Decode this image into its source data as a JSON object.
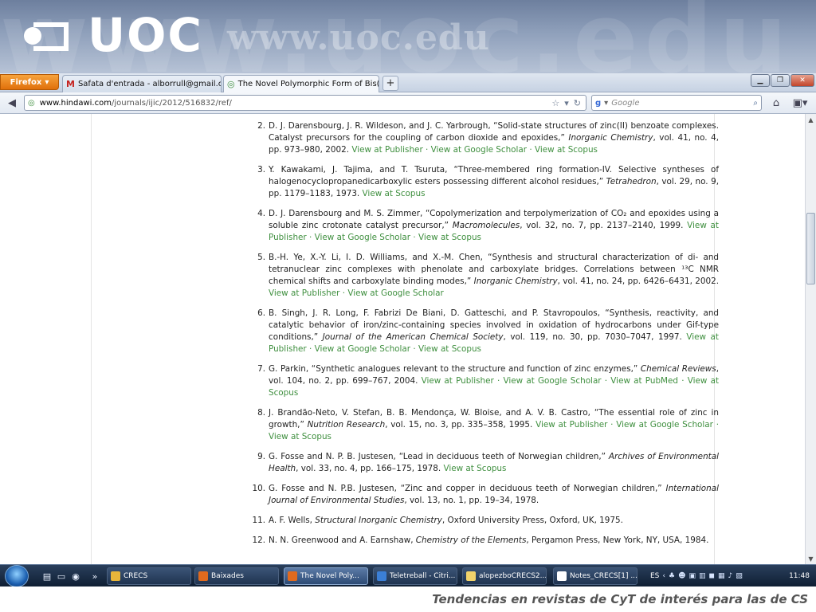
{
  "banner": {
    "logo_text": "UOC",
    "url_text": "www.uoc.edu"
  },
  "browser": {
    "app_button": "Firefox",
    "tabs": [
      {
        "title": "Safata d'entrada - alborrull@gmail.co...",
        "icon": "gmail-icon"
      },
      {
        "title": "The Novel Polymorphic Form of Bis(3...",
        "icon": "site-icon"
      }
    ],
    "url_domain": "www.hindawi.com",
    "url_path": "/journals/ijic/2012/516832/ref/",
    "search_placeholder": "Google"
  },
  "references": [
    {
      "num": "2.",
      "text": "D. J. Darensbourg, J. R. Wildeson, and J. C. Yarbrough, “Solid-state structures of zinc(II) benzoate complexes. Catalyst precursors for the coupling of carbon dioxide and epoxides,” ",
      "journal": "Inorganic Chemistry",
      "rest": ", vol. 41, no. 4, pp. 973–980, 2002. ",
      "links": [
        "View at Publisher",
        "View at Google Scholar",
        "View at Scopus"
      ]
    },
    {
      "num": "3.",
      "text": "Y. Kawakami, J. Tajima, and T. Tsuruta, “Three-membered ring formation-IV. Selective syntheses of halogenocyclopropanedicarboxylic esters possessing different alcohol residues,” ",
      "journal": "Tetrahedron",
      "rest": ", vol. 29, no. 9, pp. 1179–1183, 1973. ",
      "links": [
        "View at Scopus"
      ]
    },
    {
      "num": "4.",
      "text": "D. J. Darensbourg and M. S. Zimmer, “Copolymerization and terpolymerization of CO₂ and epoxides using a soluble zinc crotonate catalyst precursor,” ",
      "journal": "Macromolecules",
      "rest": ", vol. 32, no. 7, pp. 2137–2140, 1999. ",
      "links": [
        "View at Publisher",
        "View at Google Scholar",
        "View at Scopus"
      ]
    },
    {
      "num": "5.",
      "text": "B.-H. Ye, X.-Y. Li, I. D. Williams, and X.-M. Chen, “Synthesis and structural characterization of di- and tetranuclear zinc complexes with phenolate and carboxylate bridges. Correlations between ¹³C NMR chemical shifts and carboxylate binding modes,” ",
      "journal": "Inorganic Chemistry",
      "rest": ", vol. 41, no. 24, pp. 6426–6431, 2002. ",
      "links": [
        "View at Publisher",
        "View at Google Scholar"
      ]
    },
    {
      "num": "6.",
      "text": "B. Singh, J. R. Long, F. Fabrizi De Biani, D. Gatteschi, and P. Stavropoulos, “Synthesis, reactivity, and catalytic behavior of iron/zinc-containing species involved in oxidation of hydrocarbons under Gif-type conditions,” ",
      "journal": "Journal of the American Chemical Society",
      "rest": ", vol. 119, no. 30, pp. 7030–7047, 1997. ",
      "links": [
        "View at Publisher",
        "View at Google Scholar",
        "View at Scopus"
      ]
    },
    {
      "num": "7.",
      "text": "G. Parkin, “Synthetic analogues relevant to the structure and function of zinc enzymes,” ",
      "journal": "Chemical Reviews",
      "rest": ", vol. 104, no. 2, pp. 699–767, 2004. ",
      "links": [
        "View at Publisher",
        "View at Google Scholar",
        "View at PubMed",
        "View at Scopus"
      ]
    },
    {
      "num": "8.",
      "text": "J. Brandão-Neto, V. Stefan, B. B. Mendonça, W. Bloise, and A. V. B. Castro, “The essential role of zinc in growth,” ",
      "journal": "Nutrition Research",
      "rest": ", vol. 15, no. 3, pp. 335–358, 1995. ",
      "links": [
        "View at Publisher",
        "View at Google Scholar",
        "View at Scopus"
      ]
    },
    {
      "num": "9.",
      "text": "G. Fosse and N. P. B. Justesen, “Lead in deciduous teeth of Norwegian children,” ",
      "journal": "Archives of Environmental Health",
      "rest": ", vol. 33, no. 4, pp. 166–175, 1978. ",
      "links": [
        "View at Scopus"
      ]
    },
    {
      "num": "10.",
      "text": "G. Fosse and N. P.B. Justesen, “Zinc and copper in deciduous teeth of Norwegian children,” ",
      "journal": "International Journal of Environmental Studies",
      "rest": ", vol. 13, no. 1, pp. 19–34, 1978. ",
      "links": []
    },
    {
      "num": "11.",
      "text": "A. F. Wells, ",
      "journal": "Structural Inorganic Chemistry",
      "rest": ", Oxford University Press, Oxford, UK, 1975. ",
      "links": []
    },
    {
      "num": "12.",
      "text": "N. N. Greenwood and A. Earnshaw, ",
      "journal": "Chemistry of the Elements",
      "rest": ", Pergamon Press, New York, NY, USA, 1984. ",
      "links": []
    }
  ],
  "taskbar": {
    "tasks": [
      {
        "label": "CRECS",
        "color": "#e7b53a"
      },
      {
        "label": "Baixades",
        "color": "#e06a1e"
      },
      {
        "label": "The Novel Poly...",
        "color": "#e06a1e"
      },
      {
        "label": "Teletreball - Citri...",
        "color": "#3b7fd6"
      },
      {
        "label": "alopezboCRECS2...",
        "color": "#f2d36b"
      },
      {
        "label": "Notes_CRECS[1] ...",
        "color": "#ffffff"
      }
    ],
    "language": "ES",
    "clock": "11:48"
  },
  "footer": {
    "text": "Tendencias en revistas de CyT de interés para las de CS"
  }
}
